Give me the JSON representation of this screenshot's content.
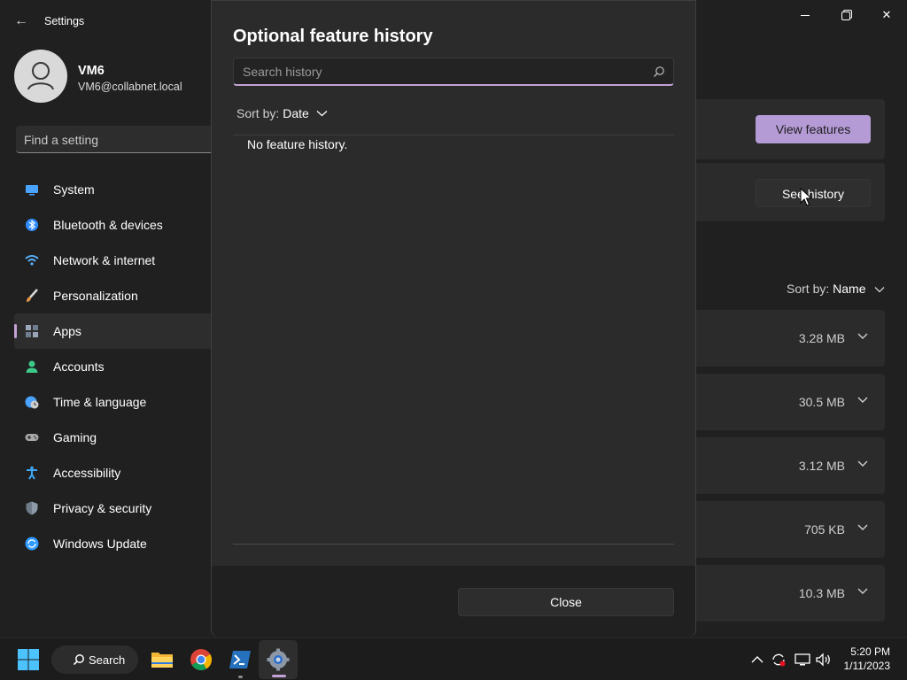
{
  "window": {
    "title": "Settings"
  },
  "profile": {
    "name": "VM6",
    "email": "VM6@collabnet.local"
  },
  "search": {
    "placeholder": "Find a setting"
  },
  "sidebar": {
    "items": [
      {
        "label": "System",
        "icon": "system-icon",
        "color": "#4aa3ff"
      },
      {
        "label": "Bluetooth & devices",
        "icon": "bluetooth-icon",
        "color": "#2f8cff"
      },
      {
        "label": "Network & internet",
        "icon": "wifi-icon",
        "color": "#58b4ff"
      },
      {
        "label": "Personalization",
        "icon": "brush-icon",
        "color": "#e59b4a"
      },
      {
        "label": "Apps",
        "icon": "apps-icon",
        "color": "#9aa7b8",
        "active": true
      },
      {
        "label": "Accounts",
        "icon": "person-icon",
        "color": "#3cc98a"
      },
      {
        "label": "Time & language",
        "icon": "globe-clock-icon",
        "color": "#4aa3ff"
      },
      {
        "label": "Gaming",
        "icon": "gamepad-icon",
        "color": "#a8a8a8"
      },
      {
        "label": "Accessibility",
        "icon": "accessibility-icon",
        "color": "#3fa9f5"
      },
      {
        "label": "Privacy & security",
        "icon": "shield-icon",
        "color": "#8e9aa8"
      },
      {
        "label": "Windows Update",
        "icon": "update-icon",
        "color": "#2f9bff"
      }
    ]
  },
  "content": {
    "view_features_label": "View features",
    "see_history_label": "See history",
    "sort_prefix": "Sort by:",
    "sort_value": "Name",
    "sizes": [
      "3.28 MB",
      "30.5 MB",
      "3.12 MB",
      "705 KB",
      "10.3 MB"
    ]
  },
  "dialog": {
    "title": "Optional feature history",
    "search_placeholder": "Search history",
    "sort_prefix": "Sort by:",
    "sort_value": "Date",
    "empty_message": "No feature history.",
    "close_label": "Close"
  },
  "taskbar": {
    "search_label": "Search",
    "time": "5:20 PM",
    "date": "1/11/2023"
  },
  "colors": {
    "accent": "#c3a2d6",
    "primary_button": "#b59bd6"
  }
}
